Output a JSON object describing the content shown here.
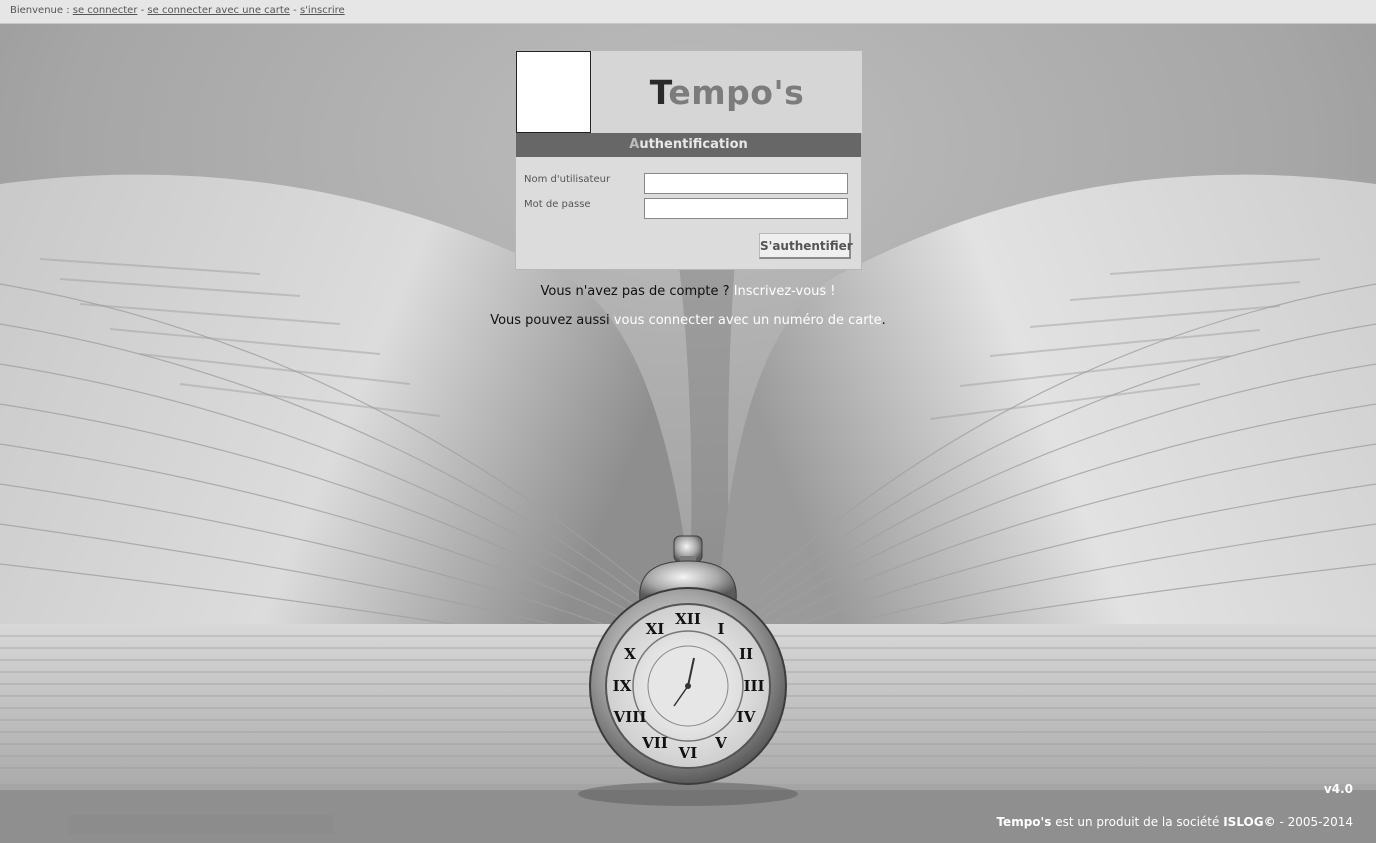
{
  "topbar": {
    "welcome": "Bienvenue :",
    "links": [
      "se connecter",
      "se connecter avec une carte",
      "s'inscrire"
    ],
    "separator": "-"
  },
  "login": {
    "brand_first": "T",
    "brand_rest": "empo's",
    "header_first": "A",
    "header_rest": "uthentification",
    "username_label": "Nom d'utilisateur",
    "username_value": "",
    "password_label": "Mot de passe",
    "password_value": "",
    "submit_label": "S'authentifier"
  },
  "messages": {
    "no_account_text": "Vous n'avez pas de compte ?",
    "no_account_link": "Inscrivez-vous !",
    "card_text": "Vous pouvez aussi",
    "card_link": "vous connecter avec un numéro de carte",
    "card_end": "."
  },
  "footer": {
    "version": "v4.0",
    "product": "Tempo's",
    "text_middle": "est un produit de la société",
    "company": "ISLOG©",
    "years": "- 2005-2014"
  },
  "colors": {
    "topbar_bg": "#e6e6e6",
    "box_bg": "#dcdcdc",
    "header_bg": "#676767",
    "link_white": "#ffffff"
  }
}
